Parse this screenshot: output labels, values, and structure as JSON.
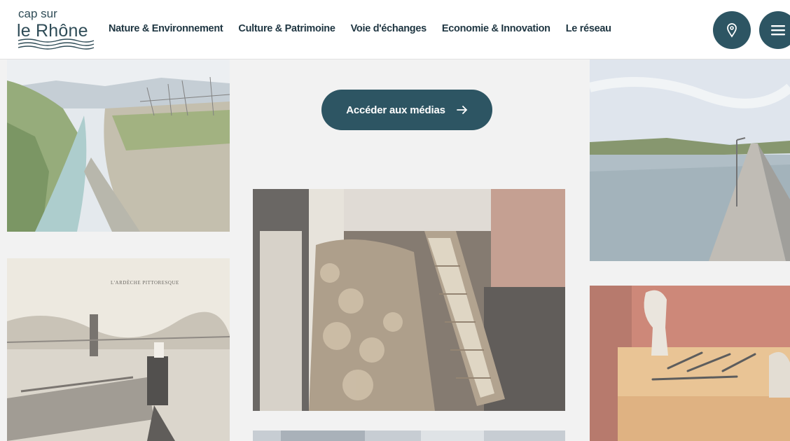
{
  "logo": {
    "line1": "cap sur",
    "line2": "le Rhône"
  },
  "nav": {
    "items": [
      {
        "label": "Nature & Environnement"
      },
      {
        "label": "Culture & Patrimoine"
      },
      {
        "label": "Voie d'échanges"
      },
      {
        "label": "Economie & Innovation"
      },
      {
        "label": "Le réseau"
      }
    ]
  },
  "header_buttons": {
    "map_icon": "map-pin-icon",
    "menu_icon": "hamburger-menu-icon"
  },
  "cta": {
    "label": "Accéder aux médias",
    "icon": "arrow-right-icon"
  },
  "postcard": {
    "caption": "L'ARDÈCHE PITTORESQUE"
  },
  "colors": {
    "accent": "#2d5563",
    "nav_text": "#1f3642",
    "background": "#f2f2f2"
  }
}
